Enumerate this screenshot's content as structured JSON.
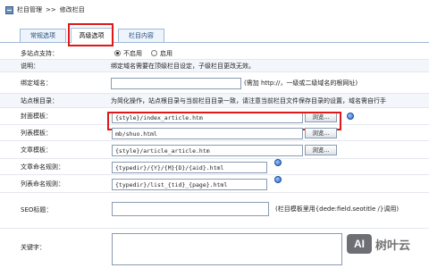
{
  "breadcrumb": {
    "root": "栏目管理",
    "sep": ">>",
    "current": "修改栏目"
  },
  "tabs": [
    {
      "label": "常规选项",
      "active": false
    },
    {
      "label": "高级选项",
      "active": true
    },
    {
      "label": "栏目内容",
      "active": false
    }
  ],
  "form": {
    "multi_site": {
      "label": "多站点支持：",
      "off_label": "不启用",
      "on_label": "启用",
      "selected": "不启用"
    },
    "note": {
      "label": "说明：",
      "text": "绑定域名需要在顶级栏目设定，子级栏目更改无效。"
    },
    "domain": {
      "label": "绑定域名：",
      "value": "",
      "hint": "(需加 http://，一级或二级域名的根网址)"
    },
    "site_root": {
      "label": "站点根目录：",
      "text": "为简化操作，站点根目录与当前栏目目录一致，请注意当前栏目文件保存目录的设置，域名需自行手"
    },
    "cover_template": {
      "label": "封面模板：",
      "value": "{style}/index_article.htm",
      "browse": "浏览..."
    },
    "list_template": {
      "label": "列表模板：",
      "value": "mb/shuo.html",
      "browse": "浏览..."
    },
    "article_template": {
      "label": "文章模板：",
      "value": "{style}/article_article.htm",
      "browse": "浏览..."
    },
    "article_naming": {
      "label": "文章命名规则：",
      "value": "{typedir}/{Y}/{M}{D}/{aid}.html"
    },
    "list_naming": {
      "label": "列表命名规则：",
      "value": "{typedir}/list_{tid}_{page}.html"
    },
    "seo_title": {
      "label": "SEO标题：",
      "value": "",
      "hint": "(栏目模板里用{dede:field.seotitle /}调用)"
    },
    "keywords": {
      "label": "关键字：",
      "value": ""
    }
  },
  "watermark": {
    "logo": "AI",
    "text": "树叶云"
  },
  "colors": {
    "highlight": "#e01818",
    "tab_border": "#9fb8d8"
  }
}
